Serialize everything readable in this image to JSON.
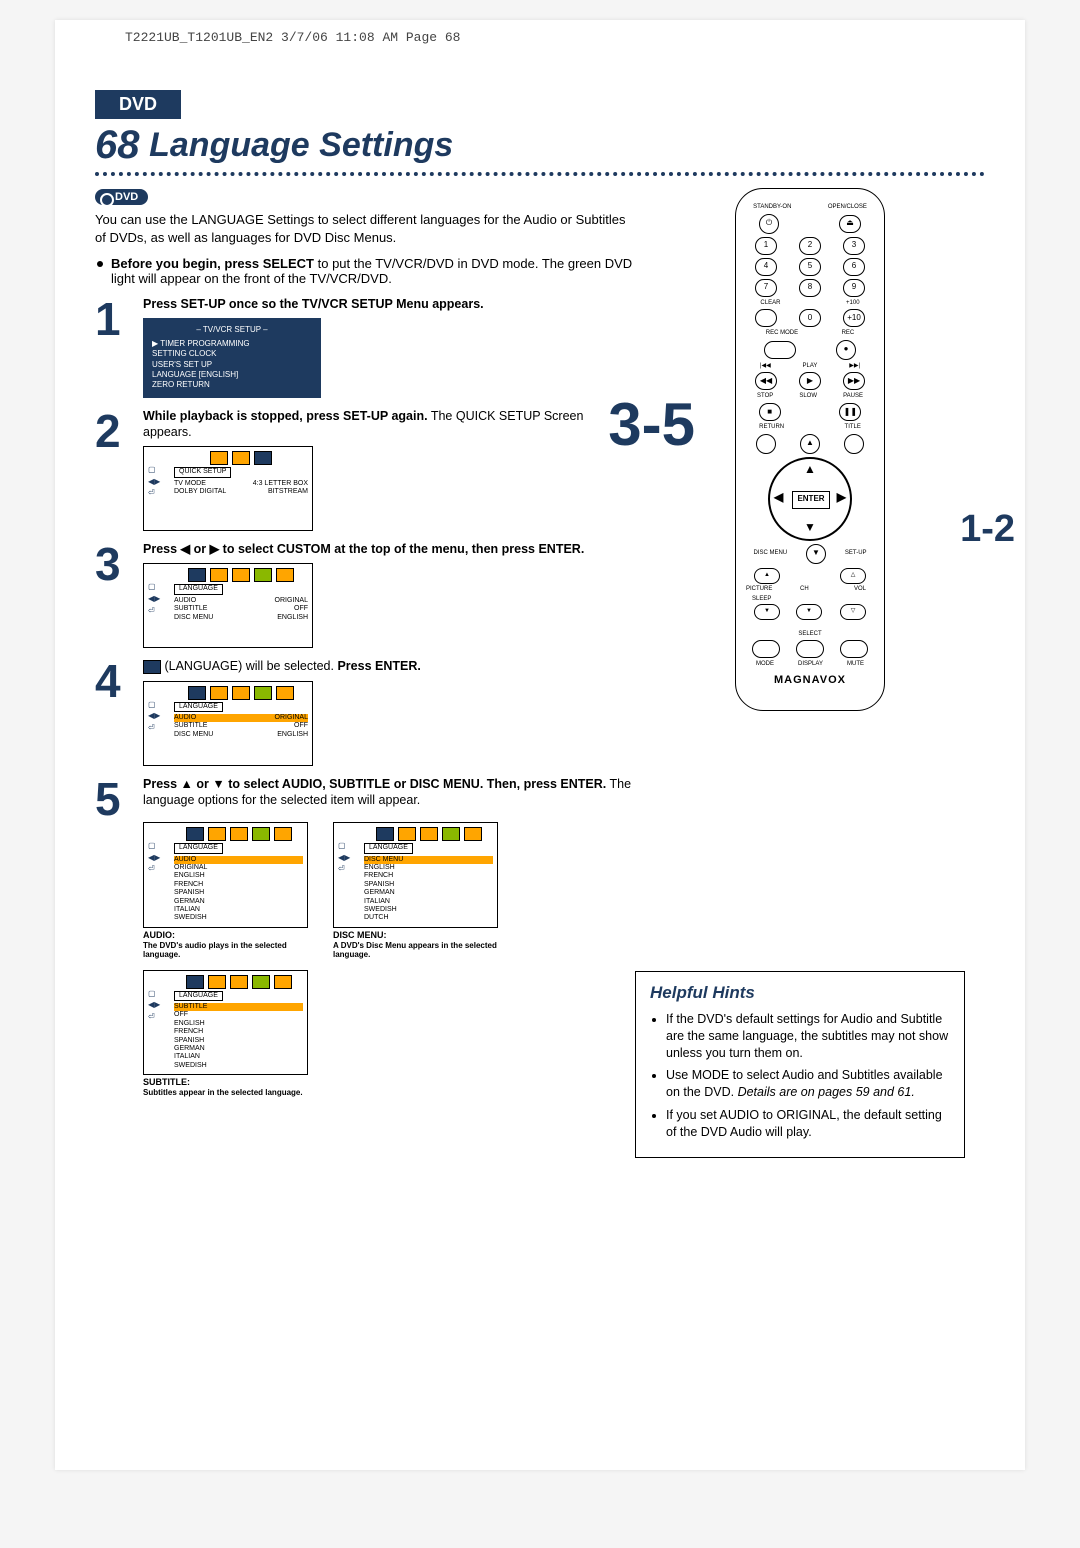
{
  "print_header": "T2221UB_T1201UB_EN2  3/7/06  11:08 AM  Page 68",
  "header": {
    "tag": "DVD"
  },
  "page_number": "68",
  "page_title": "Language Settings",
  "dvd_badge": "DVD",
  "intro": "You can use the LANGUAGE Settings to select different languages for the Audio or Subtitles of DVDs, as well as languages for DVD Disc Menus.",
  "pre_bullet_bold": "Before you begin, press SELECT",
  "pre_bullet_rest": " to put the TV/VCR/DVD in DVD mode. The green DVD light will appear on the front of the TV/VCR/DVD.",
  "steps": {
    "s1": {
      "num": "1",
      "text": "Press SET-UP once so the TV/VCR SETUP Menu appears.",
      "tv_header": "– TV/VCR SETUP –",
      "tv_items": [
        "▶ TIMER PROGRAMMING",
        "  SETTING CLOCK",
        "  USER'S SET UP",
        "  LANGUAGE  [ENGLISH]",
        "  ZERO RETURN"
      ]
    },
    "s2": {
      "num": "2",
      "bold1": "While playback is stopped, press SET-UP again.",
      "rest1": "The QUICK SETUP Screen appears.",
      "osd_tab": "QUICK SETUP",
      "rows": [
        {
          "l": "TV MODE",
          "r": "4:3 LETTER BOX"
        },
        {
          "l": "DOLBY DIGITAL",
          "r": "BITSTREAM"
        }
      ]
    },
    "s3": {
      "num": "3",
      "line": "Press ◀ or ▶ to select CUSTOM at the top of the menu, then press ENTER.",
      "osd_tab": "LANGUAGE",
      "rows": [
        {
          "l": "AUDIO",
          "r": "ORIGINAL"
        },
        {
          "l": "SUBTITLE",
          "r": "OFF"
        },
        {
          "l": "DISC MENU",
          "r": "ENGLISH"
        }
      ]
    },
    "s4": {
      "num": "4",
      "line_a": " (LANGUAGE) will be selected. ",
      "line_b": "Press ENTER.",
      "osd_tab": "LANGUAGE",
      "rows": [
        {
          "l": "AUDIO",
          "r": "ORIGINAL",
          "hl": true
        },
        {
          "l": "SUBTITLE",
          "r": "OFF"
        },
        {
          "l": "DISC MENU",
          "r": "ENGLISH"
        }
      ]
    },
    "s5": {
      "num": "5",
      "bold": "Press ▲ or ▼ to select AUDIO, SUBTITLE or DISC MENU. Then, press ENTER.",
      "rest": " The language options for the selected item will appear.",
      "audio_tab": "LANGUAGE",
      "audio_hl": "AUDIO",
      "audio_items": [
        "ORIGINAL",
        "ENGLISH",
        "FRENCH",
        "SPANISH",
        "GERMAN",
        "ITALIAN",
        "SWEDISH"
      ],
      "audio_cap_t": "AUDIO:",
      "audio_cap": "The DVD's audio plays in the selected language.",
      "disc_tab": "LANGUAGE",
      "disc_hl": "DISC MENU",
      "disc_items": [
        "ENGLISH",
        "FRENCH",
        "SPANISH",
        "GERMAN",
        "ITALIAN",
        "SWEDISH",
        "DUTCH"
      ],
      "disc_cap_t": "DISC MENU:",
      "disc_cap": "A DVD's Disc Menu appears in the selected language.",
      "sub_tab": "LANGUAGE",
      "sub_hl": "SUBTITLE",
      "sub_items": [
        "OFF",
        "ENGLISH",
        "FRENCH",
        "SPANISH",
        "GERMAN",
        "ITALIAN",
        "SWEDISH"
      ],
      "sub_cap_t": "SUBTITLE:",
      "sub_cap": "Subtitles appear in the selected language."
    }
  },
  "side_callout": "3-5",
  "side_callout2": "1-2",
  "remote": {
    "standby": "STANDBY-ON",
    "openclose": "OPEN/CLOSE",
    "nums": [
      "1",
      "2",
      "3",
      "4",
      "5",
      "6",
      "7",
      "8",
      "9",
      "0"
    ],
    "clear": "CLEAR",
    "plus100": "+100",
    "plus10": "+10",
    "recmode": "REC MODE",
    "rec": "REC",
    "play": "PLAY",
    "stop": "STOP",
    "slow": "SLOW",
    "pause": "PAUSE",
    "ret": "RETURN",
    "title": "TITLE",
    "enter": "ENTER",
    "disc": "DISC MENU",
    "setup": "SET-UP",
    "picture": "PICTURE",
    "sleep": "SLEEP",
    "ch": "CH",
    "vol": "VOL",
    "select": "SELECT",
    "mode": "MODE",
    "display": "DISPLAY",
    "mute": "MUTE",
    "brand": "MAGNAVOX"
  },
  "hints": {
    "title": "Helpful Hints",
    "i1": "If the DVD's default settings for Audio and Subtitle are the same language, the subtitles may not show unless you turn them on.",
    "i2a": "Use MODE to select Audio and Subtitles available on the DVD. ",
    "i2b": "Details are on pages 59 and 61.",
    "i3": "If you set AUDIO to ORIGINAL, the default setting of the DVD Audio will play."
  }
}
